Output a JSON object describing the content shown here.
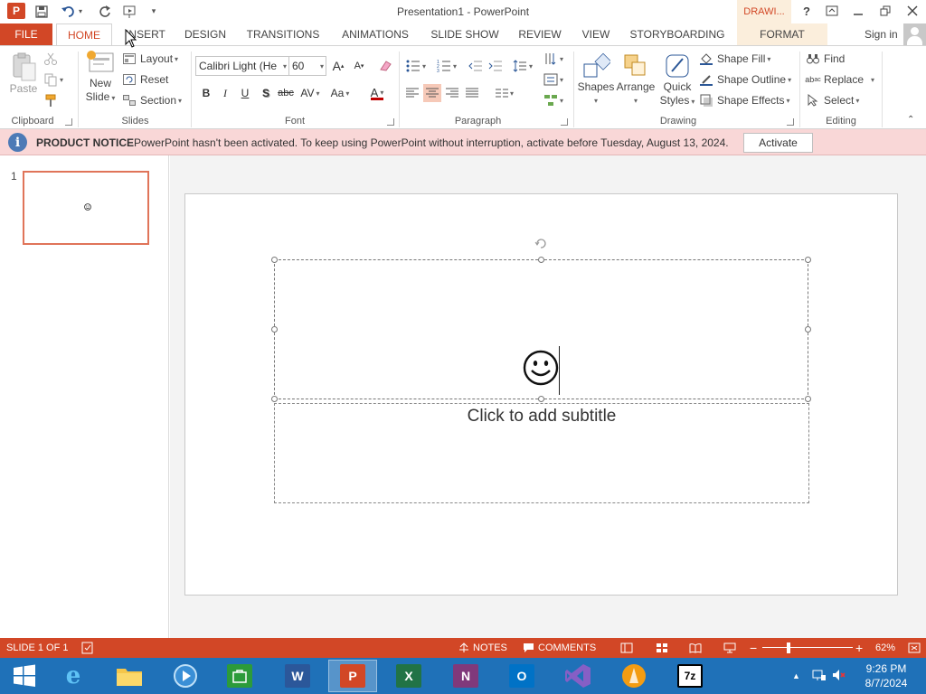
{
  "window": {
    "title": "Presentation1 - PowerPoint",
    "contextual_label": "DRAWI...",
    "help": "?",
    "app_icon_letter": "P"
  },
  "tabs": {
    "file": "FILE",
    "home": "HOME",
    "insert": "INSERT",
    "design": "DESIGN",
    "transitions": "TRANSITIONS",
    "animations": "ANIMATIONS",
    "slide_show": "SLIDE SHOW",
    "review": "REVIEW",
    "view": "VIEW",
    "storyboarding": "STORYBOARDING",
    "format": "FORMAT",
    "sign_in": "Sign in"
  },
  "ribbon": {
    "clipboard": {
      "paste": "Paste",
      "label": "Clipboard"
    },
    "slides": {
      "new_slide_line1": "New",
      "new_slide_line2": "Slide",
      "layout": "Layout",
      "reset": "Reset",
      "section": "Section",
      "label": "Slides"
    },
    "font": {
      "family": "Calibri Light (He",
      "size": "60",
      "bold": "B",
      "italic": "I",
      "underline": "U",
      "shadow": "S",
      "strike": "abc",
      "spacing": "AV",
      "case": "Aa",
      "color": "A",
      "grow": "A",
      "shrink": "A",
      "label": "Font"
    },
    "paragraph": {
      "label": "Paragraph"
    },
    "drawing": {
      "shapes": "Shapes",
      "arrange": "Arrange",
      "quick_styles_line1": "Quick",
      "quick_styles_line2": "Styles",
      "shape_fill": "Shape Fill",
      "shape_outline": "Shape Outline",
      "shape_effects": "Shape Effects",
      "label": "Drawing"
    },
    "editing": {
      "find": "Find",
      "replace": "Replace",
      "select": "Select",
      "label": "Editing"
    }
  },
  "notice": {
    "title": "PRODUCT NOTICE",
    "message": "PowerPoint hasn't been activated. To keep using PowerPoint without interruption, activate before Tuesday, August 13, 2024.",
    "button": "Activate"
  },
  "slides_pane": {
    "slide_number": "1"
  },
  "slide": {
    "subtitle_placeholder": "Click to add subtitle"
  },
  "statusbar": {
    "slide_info": "SLIDE 1 OF 1",
    "notes": "NOTES",
    "comments": "COMMENTS",
    "zoom": "62%",
    "zoom_level_percent": 62
  },
  "taskbar": {
    "apps": [
      "internet-explorer",
      "file-explorer",
      "media-player",
      "store",
      "word",
      "powerpoint",
      "excel",
      "onenote",
      "outlook",
      "visual-studio",
      "vlc",
      "7zip"
    ],
    "time": "9:26 PM",
    "date": "8/7/2024"
  },
  "colors": {
    "accent": "#d24726",
    "notice_bg": "#f9d7d7",
    "taskbar": "#1f71b8",
    "contextual_bg": "#fbeedc"
  }
}
